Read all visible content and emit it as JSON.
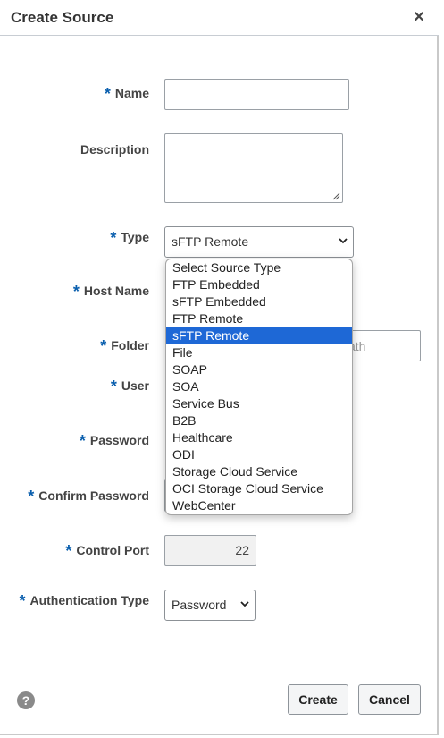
{
  "dialog": {
    "title": "Create Source",
    "close_symbol": "×"
  },
  "fields": {
    "name_label": "Name",
    "description_label": "Description",
    "type_label": "Type",
    "host_name_label": "Host Name",
    "folder_label": "Folder",
    "user_label": "User",
    "password_label": "Password",
    "confirm_password_label": "Confirm Password",
    "control_port_label": "Control Port",
    "auth_type_label": "Authentication Type",
    "required_mark": "*"
  },
  "type_select": {
    "value": "sFTP Remote",
    "options": [
      "Select Source Type",
      "FTP Embedded",
      "sFTP Embedded",
      "FTP Remote",
      "sFTP Remote",
      "File",
      "SOAP",
      "SOA",
      "Service Bus",
      "B2B",
      "Healthcare",
      "ODI",
      "Storage Cloud Service",
      "OCI Storage Cloud Service",
      "WebCenter"
    ],
    "selected_index": 4
  },
  "folder_placeholder_fragment": "ath",
  "control_port_value": "22",
  "auth_type": {
    "value": "Password"
  },
  "buttons": {
    "create": "Create",
    "cancel": "Cancel",
    "help_symbol": "?"
  },
  "colors": {
    "required": "#0a5fae",
    "selected_option": "#1e68d6"
  }
}
